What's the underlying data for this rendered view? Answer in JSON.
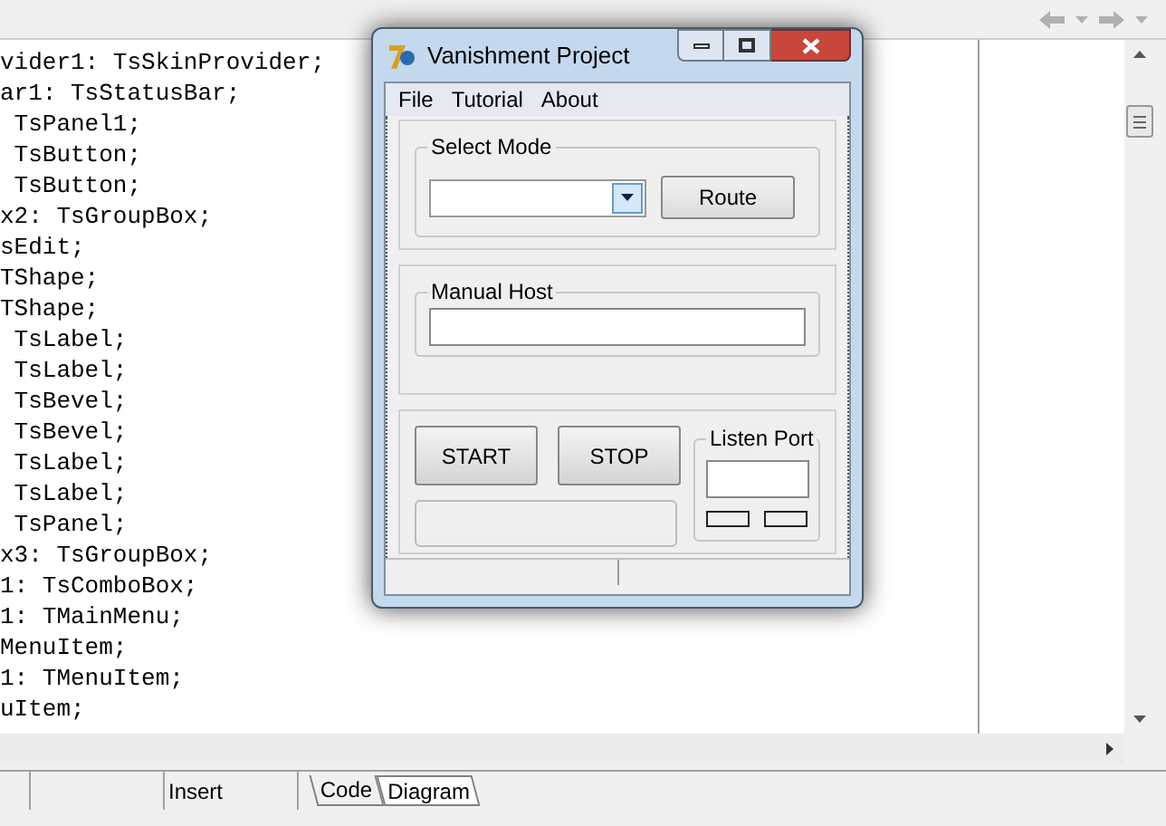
{
  "editor": {
    "code_lines": [
      "vider1: TsSkinProvider;",
      "ar1: TsStatusBar;",
      " TsPanel1;",
      " TsButton;",
      " TsButton;",
      "x2: TsGroupBox;",
      "sEdit;",
      "TShape;",
      "TShape;",
      " TsLabel;",
      " TsLabel;",
      " TsBevel;",
      " TsBevel;",
      " TsLabel;",
      " TsLabel;",
      " TsPanel;",
      "x3: TsGroupBox;",
      "1: TsComboBox;",
      "1: TMainMenu;",
      "MenuItem;",
      "1: TMenuItem;",
      "uItem;"
    ],
    "status_mode": "Insert",
    "tabs": [
      {
        "label": "Code",
        "selected": true
      },
      {
        "label": "Diagram",
        "selected": false
      }
    ]
  },
  "dialog": {
    "title": "Vanishment Project",
    "menu": [
      "File",
      "Tutorial",
      "About"
    ],
    "select_mode": {
      "label": "Select Mode",
      "button": "Route"
    },
    "manual_host": {
      "label": "Manual Host"
    },
    "buttons": [
      "START",
      "STOP"
    ],
    "listen_port": {
      "label": "Listen Port"
    }
  }
}
